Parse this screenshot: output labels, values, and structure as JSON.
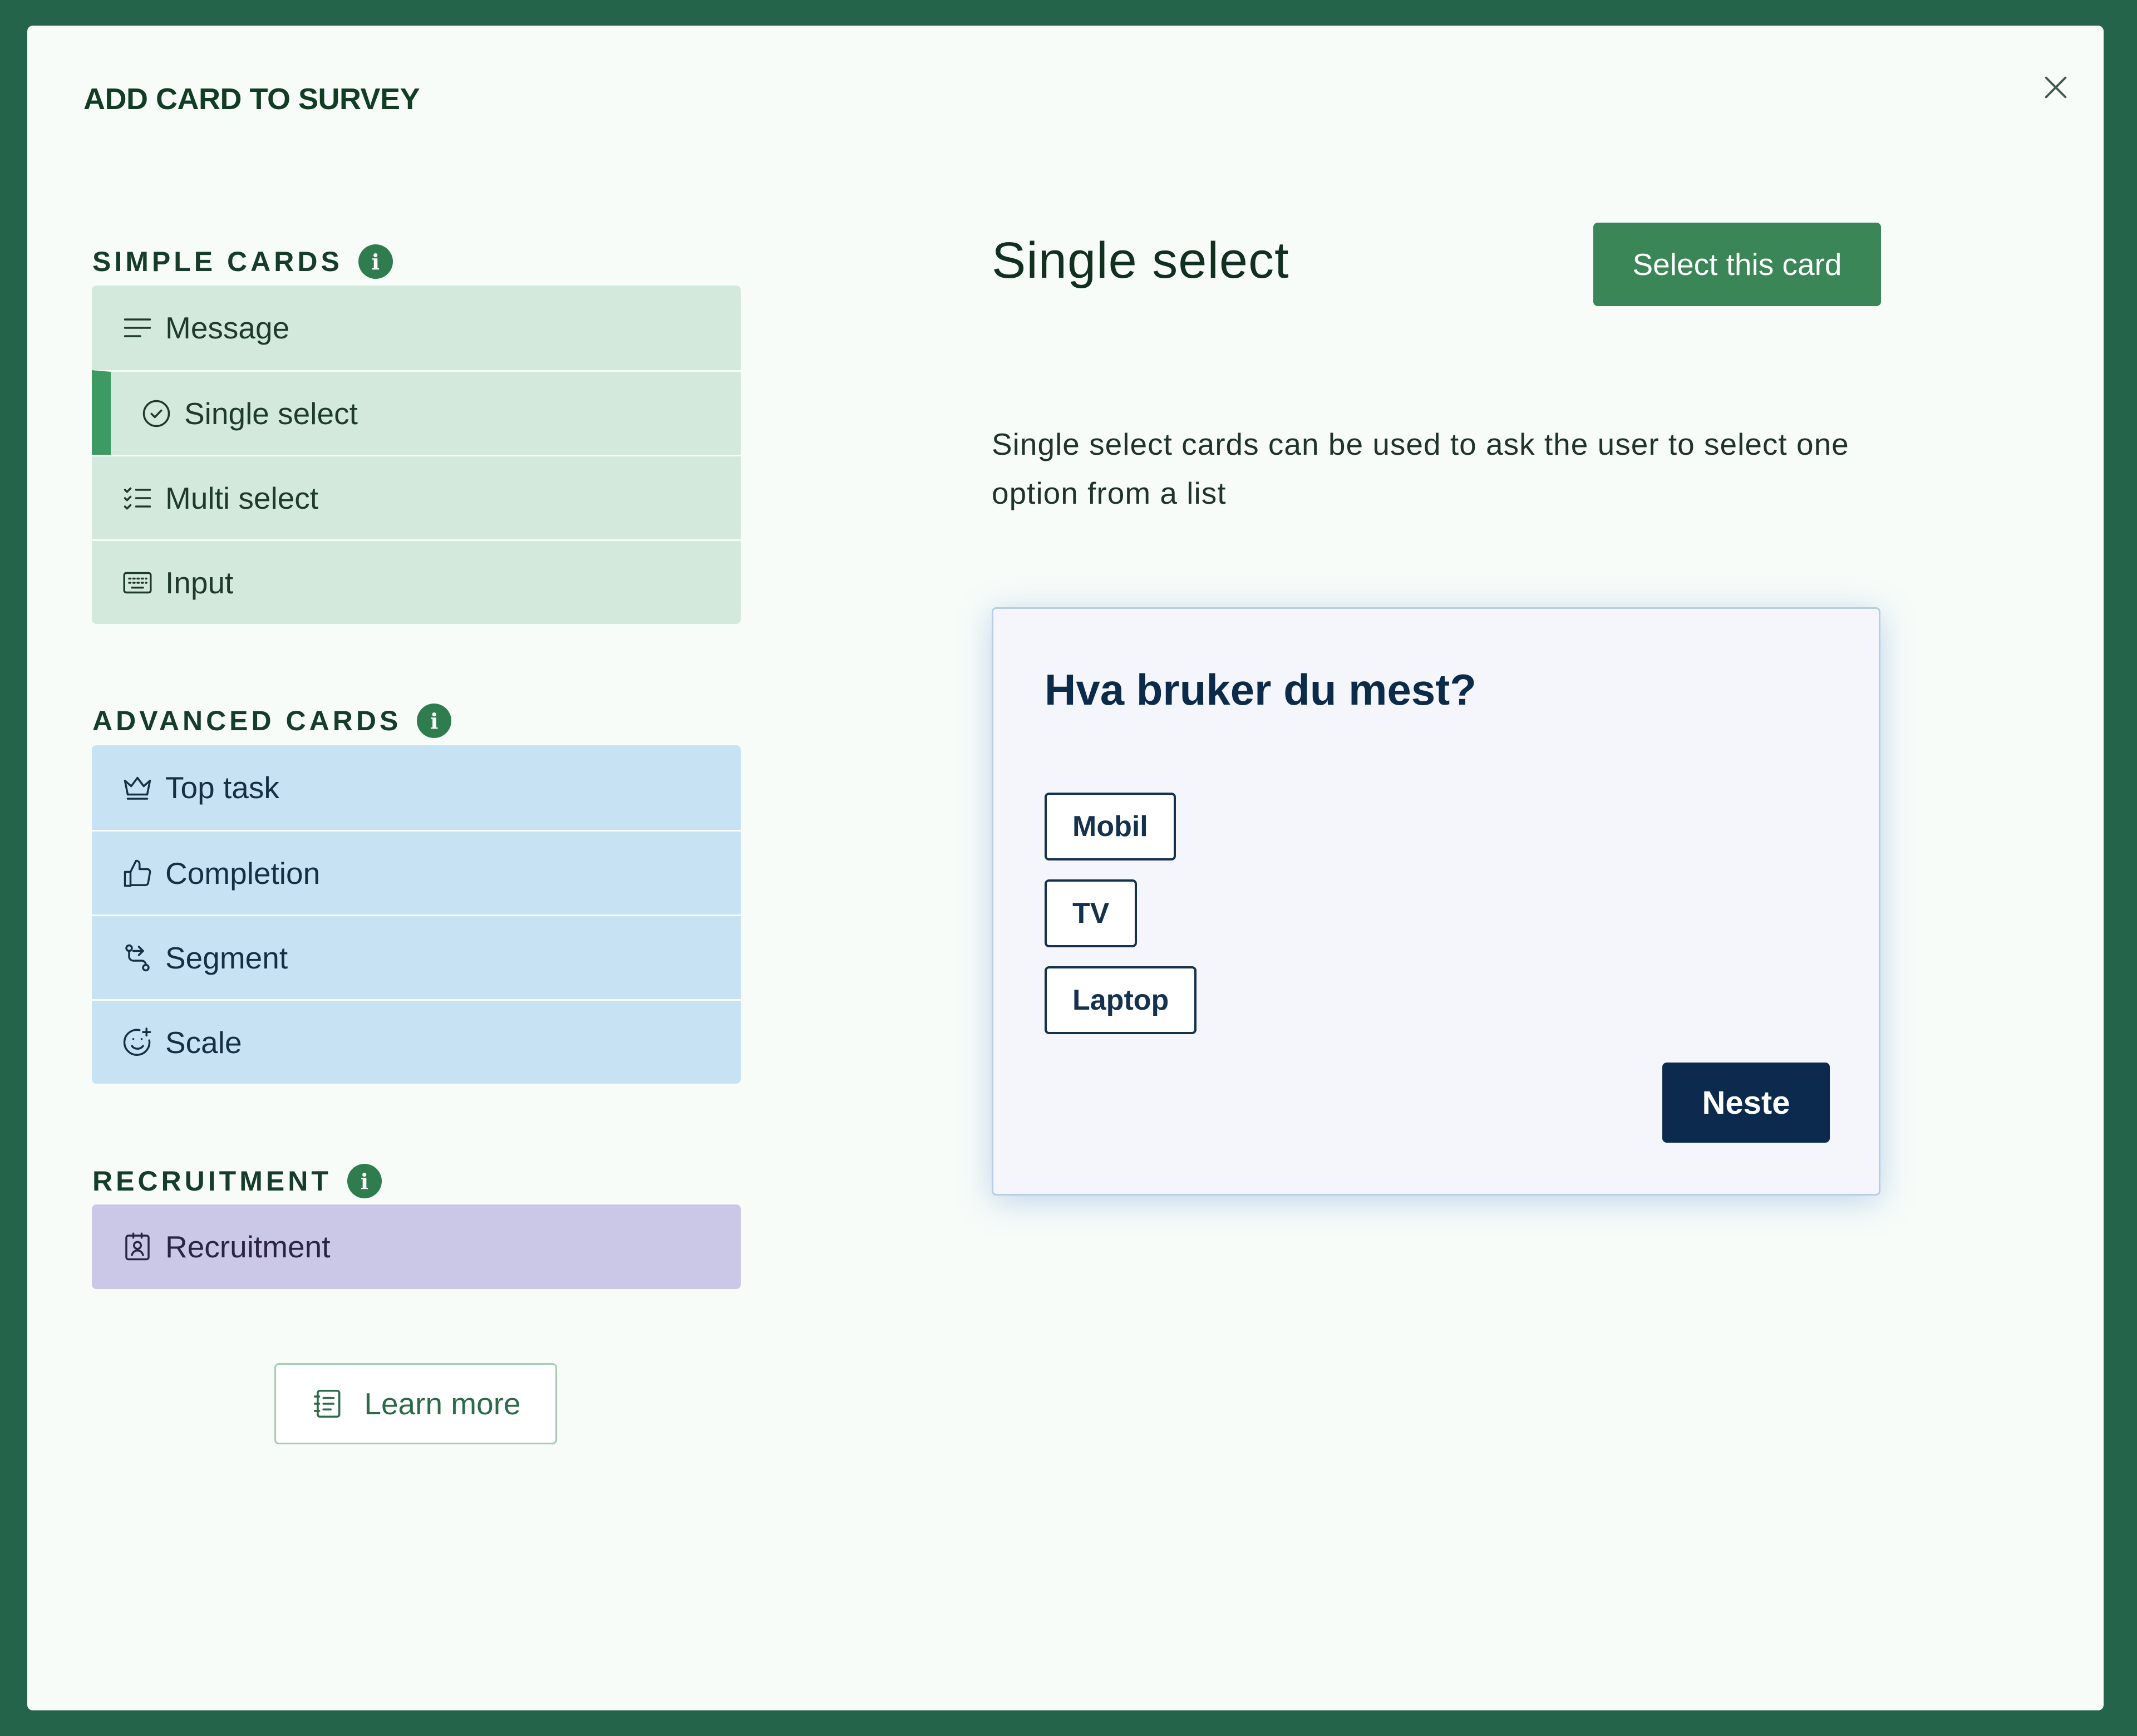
{
  "modal": {
    "title": "ADD CARD TO SURVEY"
  },
  "sections": {
    "simple": {
      "heading": "SIMPLE CARDS",
      "items": [
        {
          "label": "Message",
          "icon": "lines-icon"
        },
        {
          "label": "Single select",
          "icon": "check-circle-icon",
          "selected": true
        },
        {
          "label": "Multi select",
          "icon": "checklist-icon"
        },
        {
          "label": "Input",
          "icon": "keyboard-icon"
        }
      ]
    },
    "advanced": {
      "heading": "ADVANCED CARDS",
      "items": [
        {
          "label": "Top task",
          "icon": "crown-icon"
        },
        {
          "label": "Completion",
          "icon": "thumbs-up-icon"
        },
        {
          "label": "Segment",
          "icon": "route-icon"
        },
        {
          "label": "Scale",
          "icon": "smiley-icon"
        }
      ]
    },
    "recruitment": {
      "heading": "RECRUITMENT",
      "items": [
        {
          "label": "Recruitment",
          "icon": "contact-card-icon"
        }
      ]
    }
  },
  "learn_more": {
    "label": "Learn more",
    "icon": "notebook-icon"
  },
  "detail": {
    "title": "Single select",
    "select_button": "Select this card",
    "description": "Single select cards can be used to ask the user to select one option from a list"
  },
  "preview": {
    "question": "Hva bruker du mest?",
    "options": [
      "Mobil",
      "TV",
      "Laptop"
    ],
    "next_button": "Neste"
  },
  "colors": {
    "background": "#23644a",
    "accent_green": "#3a8657",
    "simple_bg": "#d3e9dc",
    "advanced_bg": "#c7e2f3",
    "recruitment_bg": "#cbc7e6",
    "preview_button": "#0b2a4d"
  }
}
